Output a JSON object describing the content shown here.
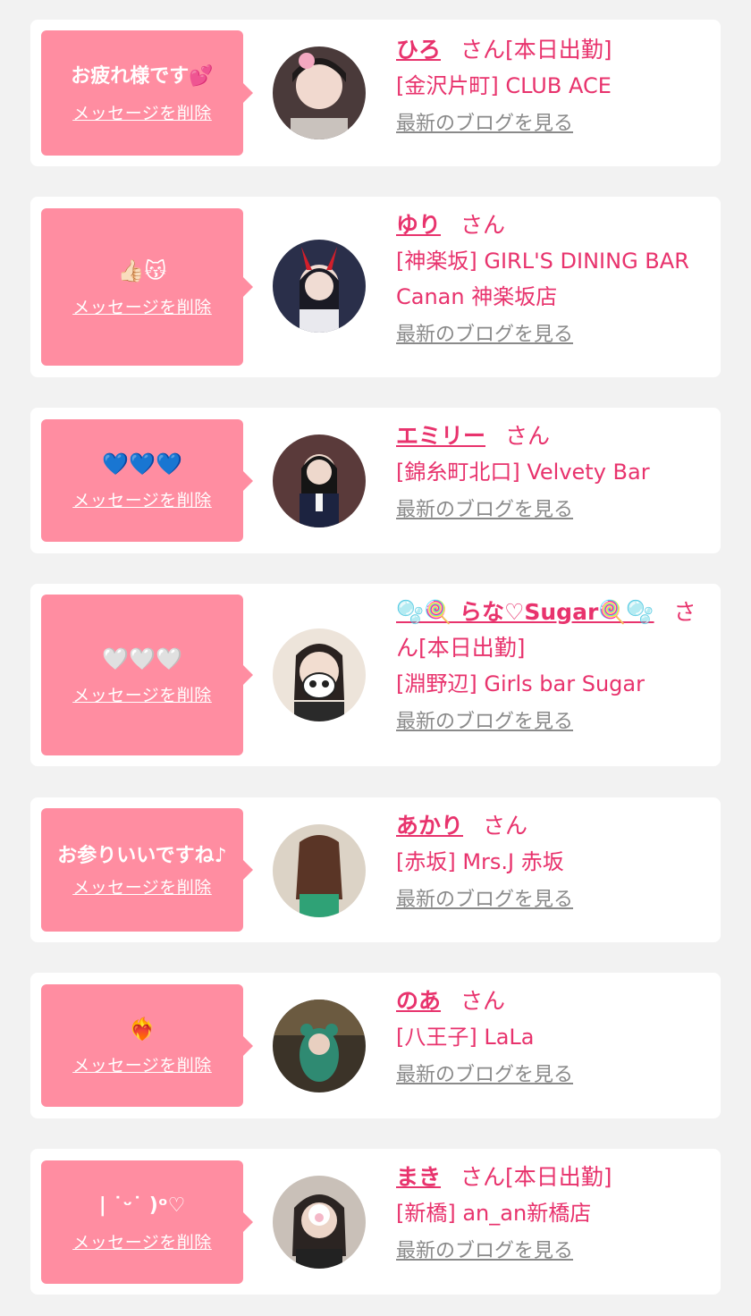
{
  "labels": {
    "delete": "メッセージを削除",
    "blog": "最新のブログを見る",
    "san": "さん"
  },
  "colors": {
    "background": "#f2f2f2",
    "card": "#ffffff",
    "bubble": "#ff8da1",
    "accent": "#e8336d",
    "link_gray": "#8a8a8a"
  },
  "items": [
    {
      "message": "お疲れ様です💕",
      "name": "ひろ",
      "status": "[本日出勤]",
      "shop": "[金沢片町] CLUB ACE",
      "avatar_icon": "avatar-photo-icon"
    },
    {
      "message": "👍🏻😽",
      "name": "ゆり",
      "status": "",
      "shop": "[神楽坂] GIRL'S DINING BAR Canan 神楽坂店",
      "avatar_icon": "avatar-photo-icon"
    },
    {
      "message": "💙💙💙",
      "name": "エミリー",
      "status": "",
      "shop": "[錦糸町北口] Velvety Bar",
      "avatar_icon": "avatar-photo-icon"
    },
    {
      "message": "🤍🤍🤍",
      "name": "🫧🍭 らな♡Sugar🍭🫧",
      "status": "[本日出勤]",
      "shop": "[淵野辺] Girls bar Sugar",
      "avatar_icon": "avatar-photo-icon"
    },
    {
      "message": "お参りいいですね♪",
      "name": "あかり",
      "status": "",
      "shop": "[赤坂] Mrs.J 赤坂",
      "avatar_icon": "avatar-photo-icon"
    },
    {
      "message": "❤️‍🔥",
      "name": "のあ",
      "status": "",
      "shop": "[八王子] LaLa",
      "avatar_icon": "avatar-photo-icon"
    },
    {
      "message": "| ˙ᵕ˙ )ᵒ♡",
      "name": "まき",
      "status": "[本日出勤]",
      "shop": "[新橋] an_an新橋店",
      "avatar_icon": "avatar-photo-icon"
    }
  ]
}
